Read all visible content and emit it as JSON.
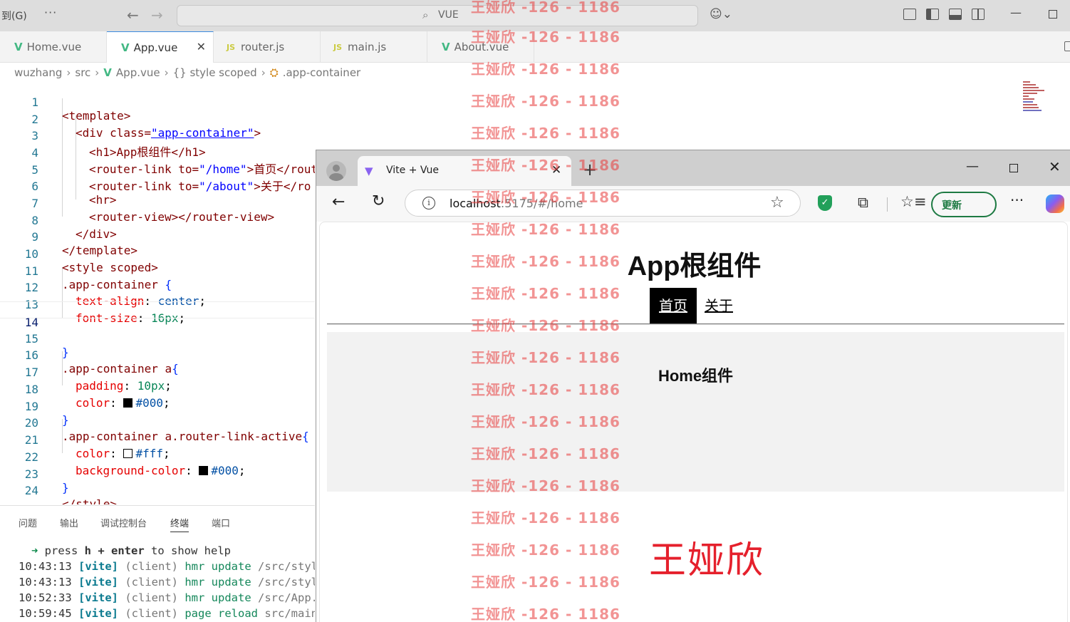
{
  "titlebar": {
    "menu_label": "到(G)",
    "more_label": "···",
    "search_text": "VUE"
  },
  "tabs": [
    {
      "label": "Home.vue",
      "type": "vue"
    },
    {
      "label": "App.vue",
      "type": "vue",
      "active": true
    },
    {
      "label": "router.js",
      "type": "js"
    },
    {
      "label": "main.js",
      "type": "js"
    },
    {
      "label": "About.vue",
      "type": "vue"
    }
  ],
  "breadcrumb": [
    "wuzhang",
    "src",
    "App.vue",
    "{} style scoped",
    ".app-container"
  ],
  "editor": {
    "line_numbers": [
      "1",
      "2",
      "3",
      "4",
      "5",
      "6",
      "7",
      "8",
      "9",
      "10",
      "11",
      "12",
      "13",
      "14",
      "15",
      "16",
      "17",
      "18",
      "19",
      "20",
      "21",
      "22",
      "23",
      "24"
    ],
    "current_line": "14",
    "lines": {
      "l1": "<template>",
      "l2_a": "<div class=",
      "l2_b": "\"app-container\"",
      "l2_c": ">",
      "l3": "<h1>App根组件</h1>",
      "l4_a": "<router-link to=",
      "l4_b": "\"/home\"",
      "l4_c": ">首页</router-link>",
      "l5_a": "<router-link to=",
      "l5_b": "\"/about\"",
      "l5_c": ">关于</ro",
      "l6": "<hr>",
      "l7": "<router-view></router-view>",
      "l8": "</div>",
      "l9": "</template>",
      "l10": "<style scoped>",
      "l11_a": ".app-container ",
      "l11_b": "{",
      "l12_a": "text-align",
      "l12_b": ": ",
      "l12_c": "center",
      "l12_d": ";",
      "l13_a": "font-size",
      "l13_b": ": ",
      "l13_c": "16px",
      "l13_d": ";",
      "l15": "}",
      "l16_a": ".app-container a",
      "l16_b": "{",
      "l17_a": "padding",
      "l17_b": ": ",
      "l17_c": "10px",
      "l17_d": ";",
      "l18_a": "color",
      "l18_b": ": ",
      "l18_c": "#000",
      "l18_d": ";",
      "l19": "}",
      "l20_a": ".app-container a.router-link-active",
      "l20_b": "{",
      "l21_a": "color",
      "l21_b": ": ",
      "l21_c": "#fff",
      "l21_d": ";",
      "l22_a": "background-color",
      "l22_b": ": ",
      "l22_c": "#000",
      "l22_d": ";",
      "l23": "}",
      "l24": "</style>"
    }
  },
  "panel": {
    "tabs": [
      "问题",
      "输出",
      "调试控制台",
      "终端",
      "端口"
    ],
    "active_tab": "终端",
    "terminal": {
      "prompt_arrow": "➜",
      "prompt_a": " press ",
      "prompt_b": "h + enter",
      "prompt_c": " to show help",
      "rows": [
        {
          "time": "10:43:13",
          "tag": "[vite]",
          "client": "(client)",
          "action": "hmr update",
          "path": "/src/style"
        },
        {
          "time": "10:43:13",
          "tag": "[vite]",
          "client": "(client)",
          "action": "hmr update",
          "path": "/src/style"
        },
        {
          "time": "10:52:33",
          "tag": "[vite]",
          "client": "(client)",
          "action": "hmr update",
          "path": "/src/App.v"
        },
        {
          "time": "10:59:45",
          "tag": "[vite]",
          "client": "(client)",
          "action": "page reload",
          "path": "src/main."
        }
      ]
    }
  },
  "browser": {
    "tab_title": "Vite + Vue",
    "url_host": "localhost",
    "url_path": ":5175/#/home",
    "update_label": "更新",
    "page": {
      "h1": "App根组件",
      "nav_home": "首页",
      "nav_about": "关于",
      "home_heading": "Home组件",
      "signature": "王娅欣"
    }
  },
  "watermark": {
    "text": "王娅欣 -126 - 1186"
  },
  "colors": {
    "accent": "#3c8be0",
    "vue_green": "#42b883",
    "watermark": "#e83c3c",
    "signature": "#e5202c",
    "update_green": "#1e7a43"
  }
}
